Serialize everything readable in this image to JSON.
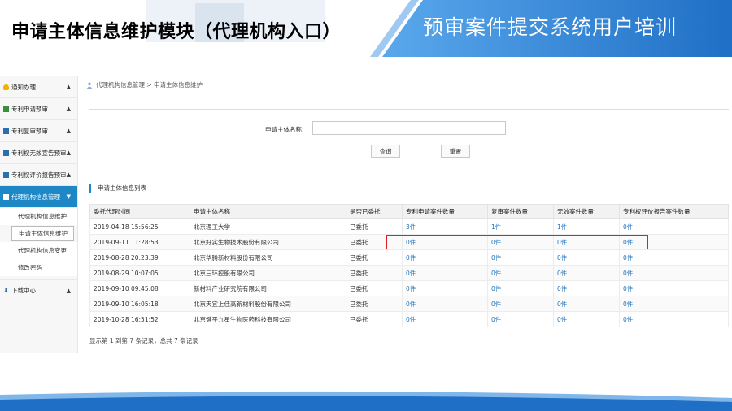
{
  "slide": {
    "title": "申请主体信息维护模块（代理机构入口）",
    "banner": "预审案件提交系统用户培训"
  },
  "sidebar": {
    "items": [
      {
        "label": "通知办理",
        "icon_color": "#f0b400"
      },
      {
        "label": "专利申请预审",
        "icon_color": "#3a8f3a"
      },
      {
        "label": "专利复审预审",
        "icon_color": "#2c6fb0"
      },
      {
        "label": "专利权无效宣告预审",
        "icon_color": "#2c6fb0"
      },
      {
        "label": "专利权评价报告预审",
        "icon_color": "#2c6fb0"
      },
      {
        "label": "代理机构信息管理",
        "icon_color": "#ffffff"
      }
    ],
    "sub_items": [
      "代理机构信息维护",
      "申请主体信息维护",
      "代理机构信息变更",
      "修改密码"
    ],
    "download": "下载中心"
  },
  "breadcrumb": "代理机构信息管理 > 申请主体信息维护",
  "search": {
    "label": "申请主体名称:",
    "value": "",
    "query_button": "查询",
    "reset_button": "重置"
  },
  "list_title": "申请主体信息列表",
  "table": {
    "headers": [
      "委托代理时间",
      "申请主体名称",
      "是否已委托",
      "专利申请案件数量",
      "复审案件数量",
      "无效案件数量",
      "专利权评价报告案件数量"
    ],
    "rows": [
      [
        "2019-04-18 15:56:25",
        "北京理工大学",
        "已委托",
        "3件",
        "1件",
        "1件",
        "0件"
      ],
      [
        "2019-09-11 11:28:53",
        "北京好实生物技术股份有限公司",
        "已委托",
        "0件",
        "0件",
        "0件",
        "0件"
      ],
      [
        "2019-08-28 20:23:39",
        "北京华腾新材料股份有限公司",
        "已委托",
        "0件",
        "0件",
        "0件",
        "0件"
      ],
      [
        "2019-08-29 10:07:05",
        "北京三环控股有限公司",
        "已委托",
        "0件",
        "0件",
        "0件",
        "0件"
      ],
      [
        "2019-09-10 09:45:08",
        "新材料产业研究院有限公司",
        "已委托",
        "0件",
        "0件",
        "0件",
        "0件"
      ],
      [
        "2019-09-10 16:05:18",
        "北京天宜上佳高新材料股份有限公司",
        "已委托",
        "0件",
        "0件",
        "0件",
        "0件"
      ],
      [
        "2019-10-28 16:51:52",
        "北京健平九星生物医药科技有限公司",
        "已委托",
        "0件",
        "0件",
        "0件",
        "0件"
      ]
    ],
    "footer": "显示第 1 到第 7 条记录，总共 7 条记录"
  },
  "colors": {
    "accent": "#1e88c7",
    "link": "#1e73be",
    "highlight": "#e02020",
    "banner": "#2a7fd4"
  }
}
